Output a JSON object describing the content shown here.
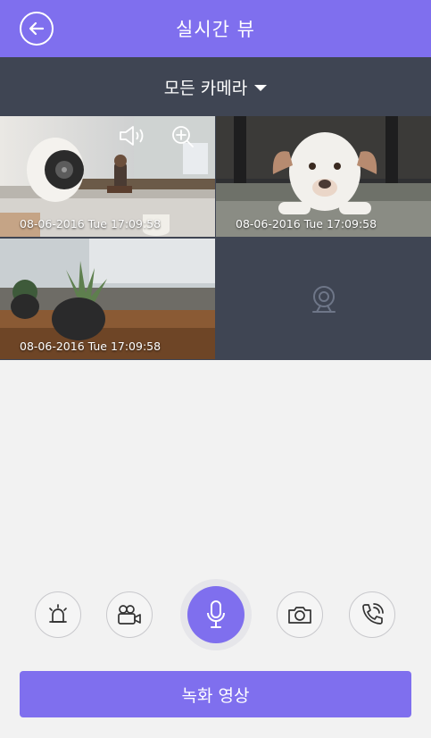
{
  "header": {
    "title": "실시간 뷰",
    "back_icon": "arrow-left-icon"
  },
  "camera_selector": {
    "label": "모든 카메라",
    "dropdown_icon": "caret-down-icon"
  },
  "feeds": [
    {
      "timestamp": "08-06-2016 Tue 17:09:58",
      "scene": "desk with speaker",
      "selected": true
    },
    {
      "timestamp": "08-06-2016 Tue 17:09:58",
      "scene": "dog lying on rug",
      "selected": false
    },
    {
      "timestamp": "08-06-2016 Tue 17:09:58",
      "scene": "plant on table",
      "selected": false
    },
    {
      "timestamp": "",
      "scene": "empty",
      "selected": false
    }
  ],
  "controls": {
    "items": [
      "siren-icon",
      "video-camera-icon",
      "microphone-icon",
      "camera-icon",
      "phone-call-icon"
    ]
  },
  "record_button": {
    "label": "녹화 영상"
  },
  "colors": {
    "accent": "#7f6fee",
    "dark_panel": "#3f4553",
    "background": "#f2f2f2"
  }
}
